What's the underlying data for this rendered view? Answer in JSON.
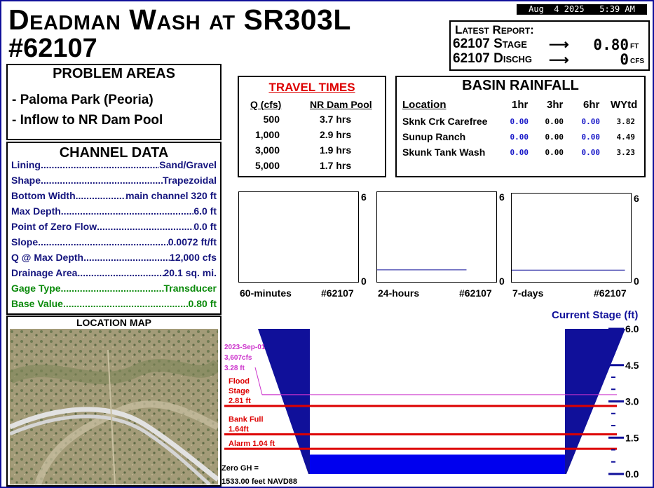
{
  "station": {
    "title_line1": "Deadman Wash at SR303L",
    "title_line2": "#62107"
  },
  "datetime": "Aug  4 2025   5:39 AM",
  "latest_report": {
    "heading": "Latest Report:",
    "stage_label": "62107 Stage",
    "stage_value": "0.80",
    "stage_unit": "FT",
    "discharge_label": "62107 Dischg",
    "discharge_value": "0",
    "discharge_unit": "CFS",
    "arrow": "⟶"
  },
  "problem_areas": {
    "heading": "PROBLEM AREAS",
    "items": [
      "- Paloma Park (Peoria)",
      "- Inflow to NR Dam Pool"
    ]
  },
  "channel_data": {
    "heading": "CHANNEL DATA",
    "rows": [
      {
        "key": "Lining",
        "value": "Sand/Gravel"
      },
      {
        "key": "Shape",
        "value": "Trapezoidal"
      },
      {
        "key": "Bottom Width",
        "value": "main channel 320 ft"
      },
      {
        "key": "Max Depth",
        "value": "6.0 ft"
      },
      {
        "key": "Point of Zero Flow",
        "value": "0.0 ft"
      },
      {
        "key": "Slope",
        "value": "0.0072 ft/ft"
      },
      {
        "key": "Q @ Max Depth",
        "value": "12,000 cfs"
      },
      {
        "key": "Drainage Area",
        "value": "20.1 sq. mi."
      },
      {
        "key": "Gage Type",
        "value": "Transducer"
      },
      {
        "key": "Base Value",
        "value": "0.80 ft"
      }
    ]
  },
  "location_map": {
    "heading": "LOCATION MAP"
  },
  "travel_times": {
    "heading": "TRAVEL TIMES",
    "col_q": "Q (cfs)",
    "col_dest": "NR Dam Pool",
    "rows": [
      {
        "q": "500",
        "t": "3.7 hrs"
      },
      {
        "q": "1,000",
        "t": "2.9 hrs"
      },
      {
        "q": "3,000",
        "t": "1.9 hrs"
      },
      {
        "q": "5,000",
        "t": "1.7 hrs"
      }
    ]
  },
  "basin_rainfall": {
    "heading": "BASIN RAINFALL",
    "columns": [
      "Location",
      "1hr",
      "3hr",
      "6hr",
      "WYtd"
    ],
    "rows": [
      {
        "name": "Sknk Crk Carefree",
        "h1": "0.00",
        "h3": "0.00",
        "h6": "0.00",
        "wytd": "3.82"
      },
      {
        "name": "Sunup Ranch",
        "h1": "0.00",
        "h3": "0.00",
        "h6": "0.00",
        "wytd": "4.49"
      },
      {
        "name": "Skunk Tank Wash",
        "h1": "0.00",
        "h3": "0.00",
        "h6": "0.00",
        "wytd": "3.23"
      }
    ]
  },
  "chart_data": [
    {
      "type": "line",
      "title": "",
      "caption_left": "60-minutes",
      "caption_right": "#62107",
      "ylim": [
        0,
        6
      ],
      "ymax_label": "6",
      "ymin_label": "0",
      "series": [
        {
          "values": []
        }
      ]
    },
    {
      "type": "line",
      "title": "",
      "caption_left": "24-hours",
      "caption_right": "#62107",
      "ylim": [
        0,
        6
      ],
      "ymax_label": "6",
      "ymin_label": "0",
      "series": [
        {
          "values": [
            0.8,
            0.8
          ]
        }
      ]
    },
    {
      "type": "line",
      "title": "",
      "caption_left": "7-days",
      "caption_right": "#62107",
      "ylim": [
        0,
        6
      ],
      "ymax_label": "6",
      "ymin_label": "0",
      "series": [
        {
          "values": [
            0.8,
            0.8
          ]
        }
      ]
    },
    {
      "type": "area",
      "title": "Current Stage (ft)",
      "ylim": [
        0,
        6
      ],
      "ticks": [
        "6.0",
        "4.5",
        "3.0",
        "1.5",
        "0.0"
      ],
      "current_stage": 0.8,
      "levels": [
        {
          "name": "record",
          "value": 3.28,
          "color": "#cc33cc",
          "lines": [
            "2023-Sep-01",
            "3,607cfs",
            "3.28 ft"
          ]
        },
        {
          "name": "flood",
          "value": 2.81,
          "color": "#dd0000",
          "lines": [
            "Flood",
            "Stage",
            "2.81 ft"
          ]
        },
        {
          "name": "bankfull",
          "value": 1.64,
          "color": "#dd0000",
          "lines": [
            "Bank Full",
            "1.64ft"
          ]
        },
        {
          "name": "alarm",
          "value": 1.04,
          "color": "#dd0000",
          "lines": [
            "Alarm 1.04 ft"
          ]
        }
      ],
      "zero_gh": [
        "Zero GH =",
        "1533.00 feet NAVD88"
      ]
    }
  ],
  "colors": {
    "navy": "#10109a",
    "water": "#0000ee",
    "red": "#dd0000",
    "green": "#0a8a0a",
    "magenta": "#cc33cc",
    "rain_blue": "#1818c8"
  }
}
